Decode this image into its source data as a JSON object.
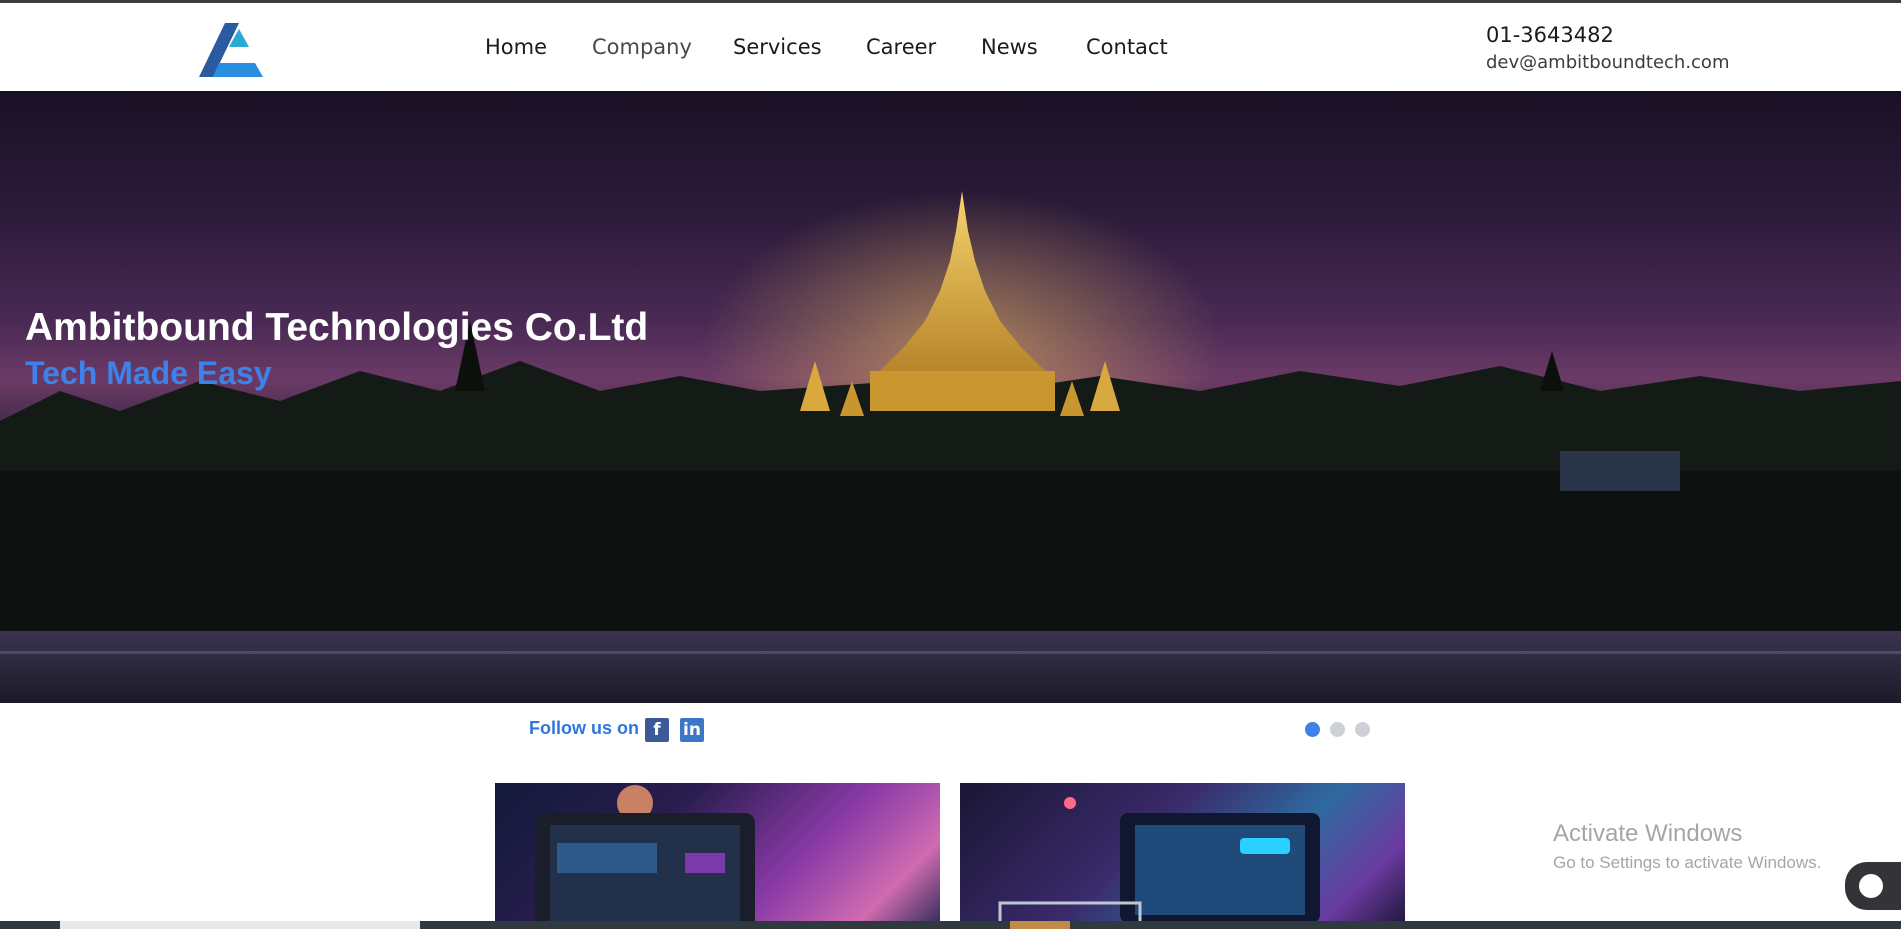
{
  "header": {
    "logo_alt": "Ambitbound logo",
    "nav": [
      {
        "label": "Home",
        "active": false
      },
      {
        "label": "Company",
        "active": true
      },
      {
        "label": "Services",
        "active": false
      },
      {
        "label": "Career",
        "active": false
      },
      {
        "label": "News",
        "active": false
      },
      {
        "label": "Contact",
        "active": false
      }
    ],
    "phone": "01-3643482",
    "email": "dev@ambitboundtech.com"
  },
  "hero": {
    "title": "Ambitbound Technologies Co.Ltd",
    "subtitle": "Tech Made Easy"
  },
  "social": {
    "follow_label": "Follow us on",
    "facebook_icon": "facebook-icon",
    "linkedin_icon": "linkedin-icon"
  },
  "slider": {
    "dot_count": 3,
    "active_index": 0
  },
  "cards": [
    {
      "name": "digital-marketing-card"
    },
    {
      "name": "ecommerce-card"
    }
  ],
  "watermark": {
    "title": "Activate Windows",
    "subtitle": "Go to Settings to activate Windows."
  },
  "colors": {
    "accent": "#3d82e8",
    "follow_text": "#2f77de",
    "dark_text": "#1b1b1b",
    "facebook": "#3a5a98",
    "linkedin": "#3b77c6"
  }
}
